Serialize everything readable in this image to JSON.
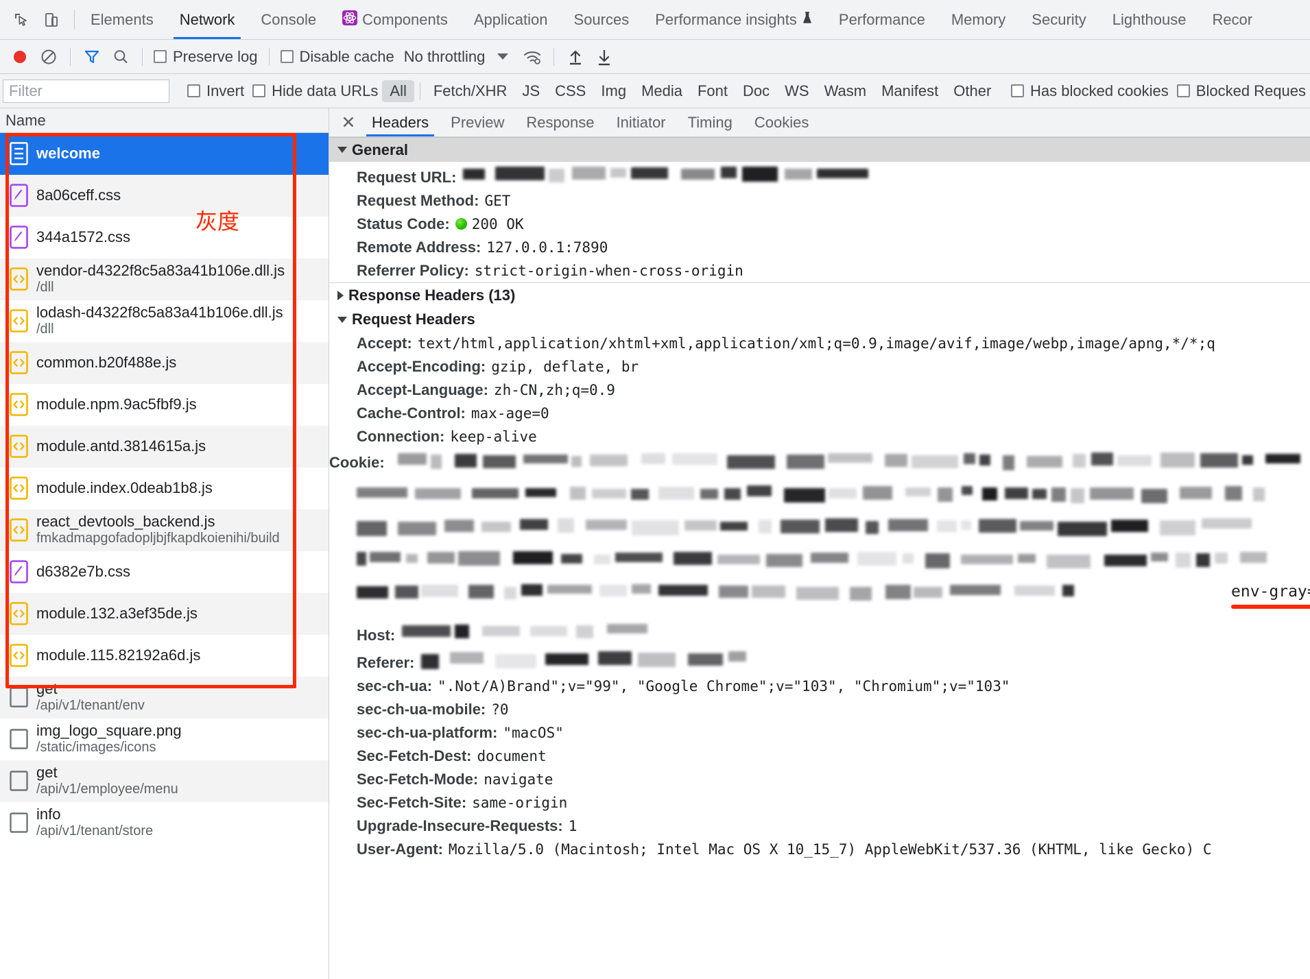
{
  "devtools": {
    "main_tabs": [
      {
        "label": "Elements",
        "active": false
      },
      {
        "label": "Network",
        "active": true
      },
      {
        "label": "Console",
        "active": false
      },
      {
        "label": "Components",
        "active": false,
        "icon": "react-components-icon"
      },
      {
        "label": "Application",
        "active": false
      },
      {
        "label": "Sources",
        "active": false
      },
      {
        "label": "Performance insights",
        "active": false,
        "icon": "flask-icon"
      },
      {
        "label": "Performance",
        "active": false
      },
      {
        "label": "Memory",
        "active": false
      },
      {
        "label": "Security",
        "active": false
      },
      {
        "label": "Lighthouse",
        "active": false
      },
      {
        "label": "Recor",
        "active": false
      }
    ],
    "toolbar": {
      "record_icon": "record-stop-icon",
      "clear_icon": "clear-no-entry-icon",
      "filter_icon": "funnel-filter-icon",
      "search_icon": "search-magnifier-icon",
      "preserve_log_label": "Preserve log",
      "preserve_log_checked": false,
      "disable_cache_label": "Disable cache",
      "disable_cache_checked": false,
      "throttling_value": "No throttling",
      "wifi_icon": "wifi-settings-icon",
      "import_icon": "upload-arrow-icon",
      "export_icon": "download-arrow-icon"
    },
    "filterbar": {
      "filter_placeholder": "Filter",
      "filter_value": "",
      "invert_label": "Invert",
      "invert_checked": false,
      "hide_data_urls_label": "Hide data URLs",
      "hide_data_urls_checked": false,
      "types": [
        {
          "label": "All",
          "selected": true
        },
        {
          "label": "Fetch/XHR",
          "selected": false
        },
        {
          "label": "JS",
          "selected": false
        },
        {
          "label": "CSS",
          "selected": false
        },
        {
          "label": "Img",
          "selected": false
        },
        {
          "label": "Media",
          "selected": false
        },
        {
          "label": "Font",
          "selected": false
        },
        {
          "label": "Doc",
          "selected": false
        },
        {
          "label": "WS",
          "selected": false
        },
        {
          "label": "Wasm",
          "selected": false
        },
        {
          "label": "Manifest",
          "selected": false
        },
        {
          "label": "Other",
          "selected": false
        }
      ],
      "has_blocked_cookies_label": "Has blocked cookies",
      "has_blocked_cookies_checked": false,
      "blocked_requests_label": "Blocked Reques",
      "blocked_requests_checked": false
    },
    "requests": {
      "column_header": "Name",
      "rows": [
        {
          "name": "welcome",
          "path": "",
          "kind": "doc",
          "selected": true
        },
        {
          "name": "8a06ceff.css",
          "path": "",
          "kind": "css",
          "selected": false
        },
        {
          "name": "344a1572.css",
          "path": "",
          "kind": "css",
          "selected": false
        },
        {
          "name": "vendor-d4322f8c5a83a41b106e.dll.js",
          "path": "/dll",
          "kind": "js",
          "selected": false
        },
        {
          "name": "lodash-d4322f8c5a83a41b106e.dll.js",
          "path": "/dll",
          "kind": "js",
          "selected": false
        },
        {
          "name": "common.b20f488e.js",
          "path": "",
          "kind": "js",
          "selected": false
        },
        {
          "name": "module.npm.9ac5fbf9.js",
          "path": "",
          "kind": "js",
          "selected": false
        },
        {
          "name": "module.antd.3814615a.js",
          "path": "",
          "kind": "js",
          "selected": false
        },
        {
          "name": "module.index.0deab1b8.js",
          "path": "",
          "kind": "js",
          "selected": false
        },
        {
          "name": "react_devtools_backend.js",
          "path": "fmkadmapgofadopljbjfkapdkoienihi/build",
          "kind": "js",
          "selected": false
        },
        {
          "name": "d6382e7b.css",
          "path": "",
          "kind": "css",
          "selected": false
        },
        {
          "name": "module.132.a3ef35de.js",
          "path": "",
          "kind": "js",
          "selected": false
        },
        {
          "name": "module.115.82192a6d.js",
          "path": "",
          "kind": "js",
          "selected": false
        },
        {
          "name": "get",
          "path": "/api/v1/tenant/env",
          "kind": "other",
          "selected": false
        },
        {
          "name": "img_logo_square.png",
          "path": "/static/images/icons",
          "kind": "other",
          "selected": false
        },
        {
          "name": "get",
          "path": "/api/v1/employee/menu",
          "kind": "other",
          "selected": false
        },
        {
          "name": "info",
          "path": "/api/v1/tenant/store",
          "kind": "other",
          "selected": false
        }
      ]
    },
    "detail": {
      "close_icon": "close-x-icon",
      "tabs": [
        {
          "label": "Headers",
          "active": true
        },
        {
          "label": "Preview",
          "active": false
        },
        {
          "label": "Response",
          "active": false
        },
        {
          "label": "Initiator",
          "active": false
        },
        {
          "label": "Timing",
          "active": false
        },
        {
          "label": "Cookies",
          "active": false
        }
      ],
      "general": {
        "title": "General",
        "expanded": true,
        "rows": [
          {
            "key": "Request URL:",
            "value": "",
            "redacted": true
          },
          {
            "key": "Request Method:",
            "value": "GET"
          },
          {
            "key": "Status Code:",
            "value": "200 OK",
            "status_dot": true
          },
          {
            "key": "Remote Address:",
            "value": "127.0.0.1:7890"
          },
          {
            "key": "Referrer Policy:",
            "value": "strict-origin-when-cross-origin"
          }
        ]
      },
      "response_headers": {
        "title": "Response Headers (13)",
        "expanded": false
      },
      "request_headers": {
        "title": "Request Headers",
        "expanded": true,
        "rows": [
          {
            "key": "Accept:",
            "value": "text/html,application/xhtml+xml,application/xml;q=0.9,image/avif,image/webp,image/apng,*/*;q"
          },
          {
            "key": "Accept-Encoding:",
            "value": "gzip, deflate, br"
          },
          {
            "key": "Accept-Language:",
            "value": "zh-CN,zh;q=0.9"
          },
          {
            "key": "Cache-Control:",
            "value": "max-age=0"
          },
          {
            "key": "Connection:",
            "value": "keep-alive"
          },
          {
            "key": "Cookie:",
            "value": "",
            "redacted": true
          },
          {
            "key": "Host:",
            "value": "",
            "redacted": true
          },
          {
            "key": "Referer:",
            "value": "",
            "redacted": true
          },
          {
            "key": "sec-ch-ua:",
            "value": "\".Not/A)Brand\";v=\"99\", \"Google Chrome\";v=\"103\", \"Chromium\";v=\"103\""
          },
          {
            "key": "sec-ch-ua-mobile:",
            "value": "?0"
          },
          {
            "key": "sec-ch-ua-platform:",
            "value": "\"macOS\""
          },
          {
            "key": "Sec-Fetch-Dest:",
            "value": "document"
          },
          {
            "key": "Sec-Fetch-Mode:",
            "value": "navigate"
          },
          {
            "key": "Sec-Fetch-Site:",
            "value": "same-origin"
          },
          {
            "key": "Upgrade-Insecure-Requests:",
            "value": "1"
          },
          {
            "key": "User-Agent:",
            "value": "Mozilla/5.0 (Macintosh; Intel Mac OS X 10_15_7) AppleWebKit/537.36 (KHTML, like Gecko) C"
          }
        ]
      },
      "cookie_annotation": "env-gray=always"
    },
    "annotations": {
      "grayscale_label": "灰度",
      "highlight_color": "#fc2a00"
    }
  }
}
